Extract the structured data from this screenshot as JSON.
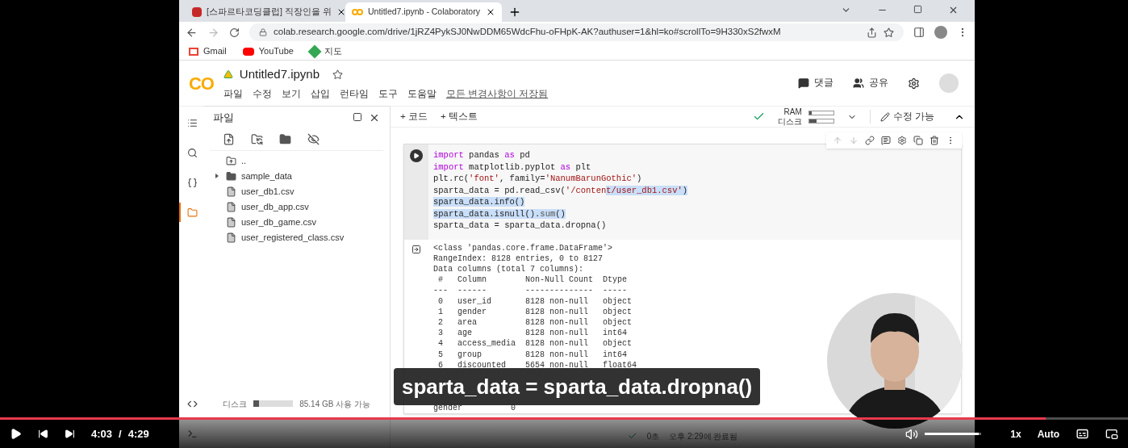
{
  "browser": {
    "tabs": [
      {
        "title": "[스파르타코딩클럽] 직장인을 위",
        "selected": false
      },
      {
        "title": "Untitled7.ipynb - Colaboratory",
        "selected": true
      }
    ],
    "url": "colab.research.google.com/drive/1jRZ4PykSJ0NwDDM65WdcFhu-oFHpK-AK?authuser=1&hl=ko#scrollTo=9H330xS2fwxM",
    "bookmarks": [
      {
        "label": "Gmail",
        "kind": "gmail"
      },
      {
        "label": "YouTube",
        "kind": "youtube"
      },
      {
        "label": "지도",
        "kind": "maps"
      }
    ]
  },
  "colab": {
    "logo": "CO",
    "title": "Untitled7.ipynb",
    "menu": [
      "파일",
      "수정",
      "보기",
      "삽입",
      "런타임",
      "도구",
      "도움말"
    ],
    "save_status": "모든 변경사항이 저장됨",
    "header_actions": [
      {
        "label": "댓글",
        "kind": "comment"
      },
      {
        "label": "공유",
        "kind": "share"
      }
    ],
    "toolbar": {
      "add_code": "+ 코드",
      "add_text": "+ 텍스트",
      "ram_label": "RAM",
      "disk_label": "디스크",
      "ram": {
        "level": 0.1
      },
      "disk": {
        "level": 0.3
      },
      "edit_mode": "수정 가능"
    },
    "rail": [
      {
        "kind": "toc",
        "selected": false
      },
      {
        "kind": "search",
        "selected": false
      },
      {
        "kind": "variables",
        "selected": false
      },
      {
        "kind": "files",
        "selected": true
      },
      {
        "kind": "snippets",
        "selected": false
      },
      {
        "kind": "terminal",
        "selected": false
      }
    ],
    "files_panel": {
      "title": "파일",
      "items": [
        {
          "name": "..",
          "kind": "parent"
        },
        {
          "name": "sample_data",
          "kind": "folder",
          "expanded": false
        },
        {
          "name": "user_db1.csv",
          "kind": "file"
        },
        {
          "name": "user_db_app.csv",
          "kind": "file"
        },
        {
          "name": "user_db_game.csv",
          "kind": "file"
        },
        {
          "name": "user_registered_class.csv",
          "kind": "file"
        }
      ],
      "disk_label": "디스크",
      "disk": {
        "level": 0.15
      },
      "disk_free": "85.14 GB 사용 가능"
    },
    "code_lines": [
      [
        {
          "text": "import",
          "kind": "keyword",
          "selected": false
        },
        {
          "text": " pandas ",
          "kind": "plain",
          "selected": false
        },
        {
          "text": "as",
          "kind": "keyword",
          "selected": false
        },
        {
          "text": " pd",
          "kind": "plain",
          "selected": false
        }
      ],
      [
        {
          "text": "import",
          "kind": "keyword",
          "selected": false
        },
        {
          "text": " matplotlib.pyplot ",
          "kind": "plain",
          "selected": false
        },
        {
          "text": "as",
          "kind": "keyword",
          "selected": false
        },
        {
          "text": " plt",
          "kind": "plain",
          "selected": false
        }
      ],
      [
        {
          "text": "plt.rc(",
          "kind": "plain",
          "selected": false
        },
        {
          "text": "'font'",
          "kind": "string",
          "selected": false
        },
        {
          "text": ", family=",
          "kind": "plain",
          "selected": false
        },
        {
          "text": "'NanumBarunGothic'",
          "kind": "string",
          "selected": false
        },
        {
          "text": ")",
          "kind": "plain",
          "selected": false
        }
      ],
      [
        {
          "text": "sparta_data = pd.read_csv(",
          "kind": "plain",
          "selected": false
        },
        {
          "text": "'/conten",
          "kind": "string",
          "selected": false
        },
        {
          "text": "t/user_db1.csv'",
          "kind": "string",
          "selected": true
        },
        {
          "text": ")",
          "kind": "plain",
          "selected": true
        }
      ],
      [
        {
          "text": "sparta_data.info()",
          "kind": "plain",
          "selected": true
        }
      ],
      [
        {
          "text": "sparta_data.isnull().",
          "kind": "plain",
          "selected": true
        },
        {
          "text": "sum",
          "kind": "builtin",
          "selected": true
        },
        {
          "text": "()",
          "kind": "plain",
          "selected": true
        }
      ],
      [
        {
          "text": "sparta_data = sparta_data.dropna()",
          "kind": "plain",
          "selected": false
        }
      ]
    ],
    "output_lines": [
      "<class 'pandas.core.frame.DataFrame'>",
      "RangeIndex: 8128 entries, 0 to 8127",
      "Data columns (total 7 columns):",
      " #   Column        Non-Null Count  Dtype  ",
      "---  ------        --------------  -----  ",
      " 0   user_id       8128 non-null   object ",
      " 1   gender        8128 non-null   object ",
      " 2   area          8128 non-null   object ",
      " 3   age           8128 non-null   int64  ",
      " 4   access_media  8128 non-null   object ",
      " 5   group         8128 non-null   int64  ",
      " 6   discounted    5654 non-null   float64"
    ],
    "output_tail": [
      "gender          0"
    ],
    "status": {
      "duration": "0초",
      "completed": "오후 2:29에 완료됨"
    }
  },
  "caption": "sparta_data = sparta_data.dropna()",
  "player": {
    "progress": {
      "level": 0.927
    },
    "current": "4:03",
    "separator": "/",
    "total": "4:29",
    "volume": {
      "level": 0.95
    },
    "speed": "1x",
    "quality": "Auto"
  }
}
